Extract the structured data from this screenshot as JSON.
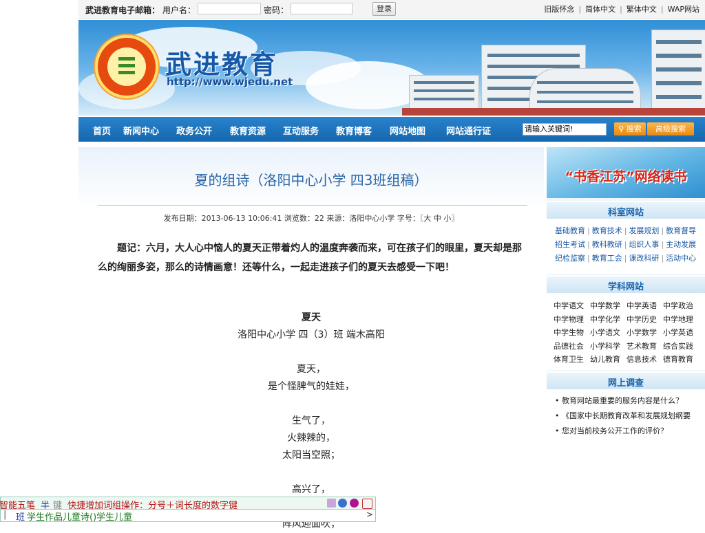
{
  "topbar": {
    "title": "武进教育电子邮箱：",
    "username_label": "用户名：",
    "password_label": "密码：",
    "login_button": "登录",
    "links": [
      "旧版怀念",
      "简体中文",
      "繁体中文",
      "WAP网站"
    ]
  },
  "banner": {
    "logo_text": "武进教育",
    "site_name": "武进教育",
    "url": "http://www.wjedu.net"
  },
  "nav": {
    "items": [
      "首页",
      "新闻中心",
      "政务公开",
      "教育资源",
      "互动服务",
      "教育博客",
      "网站地图",
      "网站通行证"
    ],
    "search_placeholder": "请输入关键词!",
    "search_button": "搜索",
    "advanced_search": "高级搜索"
  },
  "article": {
    "title": "夏的组诗（洛阳中心小学  四3班组稿）",
    "meta": "发布日期：2013-06-13 10:06:41  浏览数：22  来源：洛阳中心小学  字号：〖大  中  小〗",
    "intro": "题记：六月，大人心中恼人的夏天正带着灼人的温度奔袭而来，可在孩子们的眼里，夏天却是那么的绚丽多姿，那么的诗情画意！还等什么，一起走进孩子们的夏天去感受一下吧！",
    "poem_title": "夏天",
    "poem_author": "洛阳中心小学  四（3）班  端木高阳",
    "stanza1": [
      "夏天，",
      "是个怪脾气的娃娃，"
    ],
    "stanza2": [
      "生气了，",
      "火辣辣的，",
      "太阳当空照；"
    ],
    "stanza3": [
      "高兴了，"
    ],
    "partial_line": "阵风迎面吹；"
  },
  "sidebar": {
    "banner_text": "“书香江苏”网络读书",
    "section1_title": "科室网站",
    "section1_rows": [
      [
        "基础教育",
        "教育技术",
        "发展规划",
        "教育督导"
      ],
      [
        "招生考试",
        "教科教研",
        "组织人事",
        "主动发展"
      ],
      [
        "纪检监察",
        "教育工会",
        "课改科研",
        "活动中心"
      ]
    ],
    "section2_title": "学科网站",
    "section2_items": [
      "中学语文",
      "中学数学",
      "中学英语",
      "中学政治",
      "中学物理",
      "中学化学",
      "中学历史",
      "中学地理",
      "中学生物",
      "小学语文",
      "小学数学",
      "小学英语",
      "品德社会",
      "小学科学",
      "艺术教育",
      "综合实践",
      "体育卫生",
      "幼儿教育",
      "信息技术",
      "德育教育"
    ],
    "section3_title": "网上调查",
    "survey": [
      "教育网站最重要的服务内容是什么？",
      "《国家中长期教育改革和发展规划纲要",
      "您对当前校务公开工作的评价？"
    ]
  },
  "ime": {
    "mode": "智能五笔",
    "half": "半",
    "punct": "键",
    "hint": "快捷增加词组操作：分号＋词长度的数字键",
    "composition_prefix": "班",
    "composition": "学生作品儿童诗()学生儿童",
    "arrow": ">"
  }
}
